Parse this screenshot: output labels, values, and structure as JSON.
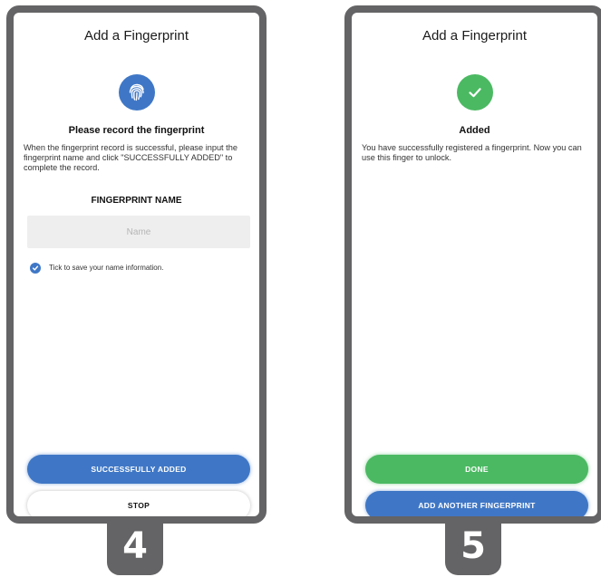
{
  "step4": {
    "step_number": "4",
    "title": "Add a Fingerprint",
    "heading": "Please record the fingerprint",
    "instructions": "When the fingerprint record is successful, please input the fingerprint name and click \"SUCCESSFULLY ADDED\"  to complete the record.",
    "name_heading": "FINGERPRINT NAME",
    "name_placeholder": "Name",
    "name_value": "",
    "save_checkbox_label": "Tick to save your name information.",
    "save_checked": true,
    "primary_button": "SUCCESSFULLY ADDED",
    "secondary_button": "STOP",
    "icon": "fingerprint-icon"
  },
  "step5": {
    "step_number": "5",
    "title": "Add a Fingerprint",
    "heading": "Added",
    "message": "You have successfully registered a fingerprint. Now you can use this finger to unlock.",
    "primary_button": "DONE",
    "secondary_button": "ADD ANOTHER FINGERPRINT",
    "icon": "checkmark-icon"
  },
  "colors": {
    "accent_blue": "#3f77c6",
    "success_green": "#4bb962",
    "frame_gray": "#646466"
  }
}
